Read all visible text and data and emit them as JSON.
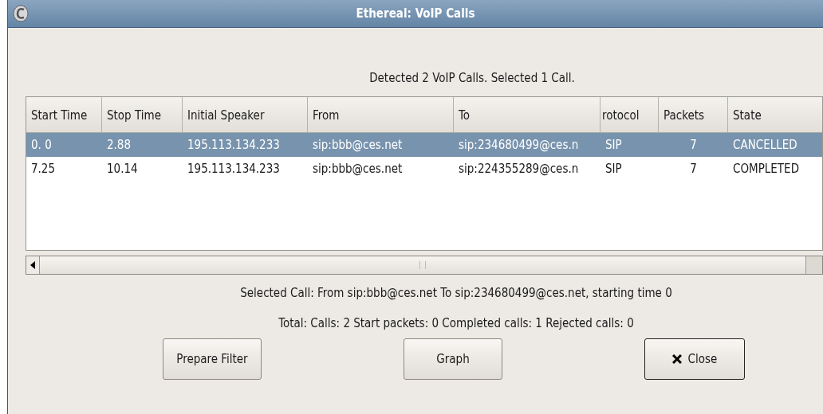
{
  "window": {
    "title": "Ethereal: VoIP Calls"
  },
  "summary": "Detected 2 VoIP Calls. Selected 1 Call.",
  "table": {
    "columns": [
      "Start Time",
      "Stop Time",
      "Initial Speaker",
      "From",
      "To",
      "rotocol",
      "Packets",
      "State"
    ],
    "rows": [
      {
        "selected": true,
        "cells": [
          "0. 0",
          "2.88",
          "195.113.134.233",
          "sip:bbb@ces.net",
          "sip:234680499@ces.n",
          "SIP",
          "7",
          "CANCELLED"
        ]
      },
      {
        "selected": false,
        "cells": [
          "7.25",
          "10.14",
          "195.113.134.233",
          "sip:bbb@ces.net",
          "sip:224355289@ces.n",
          "SIP",
          "7",
          "COMPLETED"
        ]
      }
    ]
  },
  "selected_call": "Selected Call: From  sip:bbb@ces.net  To sip:234680499@ces.net, starting time 0",
  "totals": "Total: Calls: 2   Start packets: 0   Completed calls: 1   Rejected calls: 0",
  "buttons": [
    {
      "label": "Prepare Filter",
      "kind": "plain"
    },
    {
      "label": "Graph",
      "kind": "plain"
    },
    {
      "label": "Close",
      "kind": "close"
    }
  ]
}
